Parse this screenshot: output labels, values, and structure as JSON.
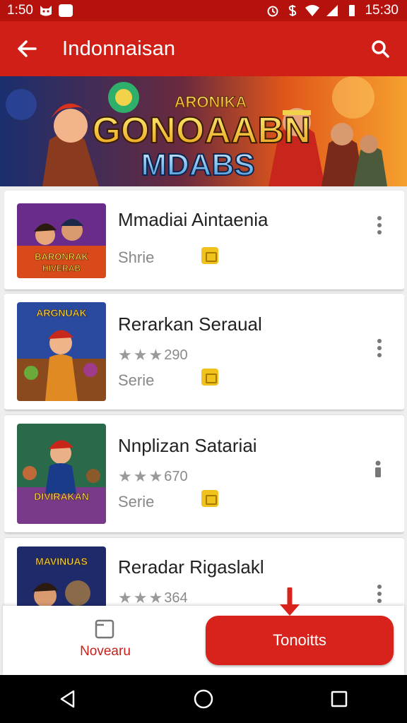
{
  "status_bar": {
    "left_time": "1:50",
    "right_time": "15:30",
    "icons": [
      "cat-icon",
      "message-icon",
      "alarm-icon",
      "dollar-icon",
      "wifi-icon",
      "signal-icon",
      "battery-icon"
    ]
  },
  "app_bar": {
    "title": "Indonnaisan",
    "back_icon": "arrow-left-icon",
    "search_icon": "search-icon"
  },
  "banner": {
    "line1": "ARONIKA",
    "line2": "GONOAABN",
    "line3": "MDABS"
  },
  "items": [
    {
      "title": "Mmadiai Aintaenia",
      "rating": "",
      "subtitle": "Shrie",
      "thumb_text": "BARONRAK HIVERAB",
      "action": "more-vertical-icon"
    },
    {
      "title": "Rerarkan Seraual",
      "rating": "290",
      "subtitle": "Serie",
      "thumb_text": "ARGNUAK",
      "action": "more-vertical-icon"
    },
    {
      "title": "Nnplizan Satariai",
      "rating": "670",
      "subtitle": "Serie",
      "thumb_text": "DIVIRAKAN",
      "action": "info-icon"
    },
    {
      "title": "Reradar Rigaslakl",
      "rating": "364",
      "subtitle": "",
      "thumb_text": "MAVINUAS",
      "action": "more-vertical-icon"
    }
  ],
  "bottom_bar": {
    "nav_label": "Novearu",
    "button_label": "Tonoitts"
  },
  "colors": {
    "status": "#b5120e",
    "app_bar": "#cf1f17",
    "accent": "#d7231b",
    "badge": "#f1c11c"
  }
}
